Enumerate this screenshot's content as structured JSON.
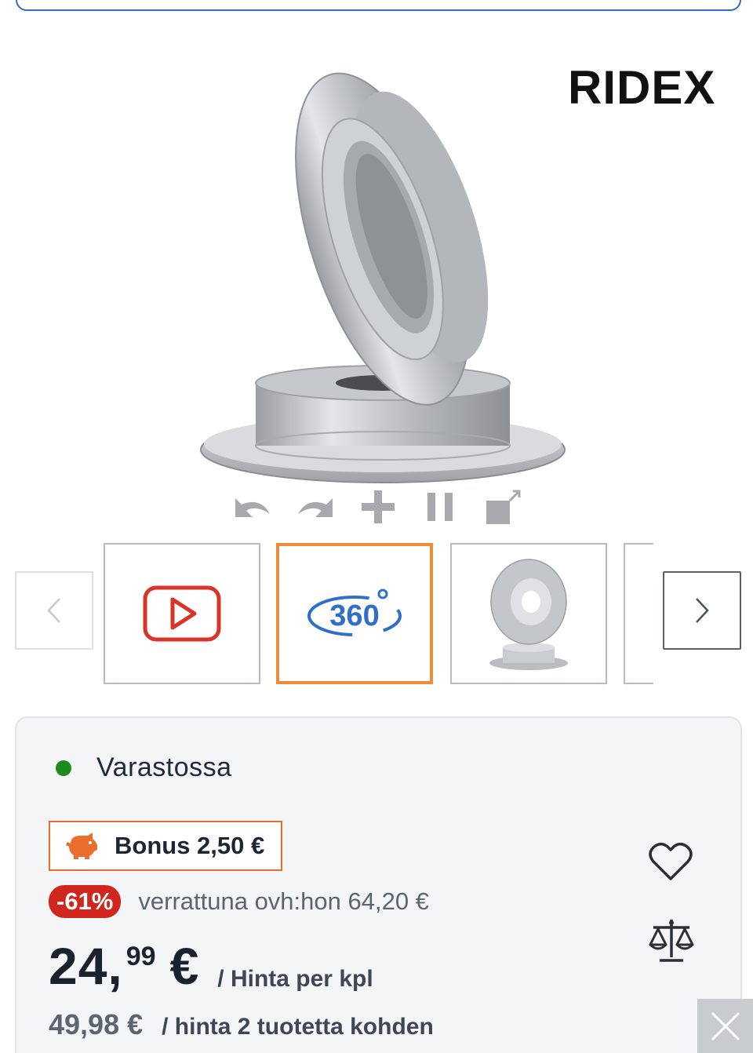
{
  "product": {
    "brand": "RIDEX"
  },
  "viewer": {
    "controls": [
      "rotate-left-icon",
      "rotate-right-icon",
      "zoom-in-icon",
      "pause-icon",
      "fullscreen-icon"
    ]
  },
  "thumbnails": {
    "items": [
      {
        "name": "video-thumbnail",
        "icon": "play-icon"
      },
      {
        "name": "360-view-thumbnail",
        "label": "360",
        "active": true
      },
      {
        "name": "disc-photo-thumbnail",
        "icon": "brake-disc"
      }
    ],
    "prev_icon": "chevron-left-icon",
    "next_icon": "chevron-right-icon"
  },
  "availability": {
    "status": "Varastossa",
    "color": "#1d8a1d"
  },
  "bonus": {
    "label": "Bonus 2,50 €",
    "icon": "piggy-bank-icon",
    "color": "#ea6d2c"
  },
  "discount": {
    "badge": "-61%",
    "compare_text": "verrattuna ovh:hon 64,20 €",
    "badge_color": "#d0261e"
  },
  "price": {
    "integer": "24,",
    "cents": "99",
    "currency": "€",
    "unit": "/ Hinta per kpl"
  },
  "total": {
    "price": "49,98 €",
    "label": "/ hinta 2 tuotetta kohden"
  },
  "actions": {
    "wishlist_icon": "heart-icon",
    "compare_icon": "scales-icon",
    "close_icon": "close-icon"
  }
}
